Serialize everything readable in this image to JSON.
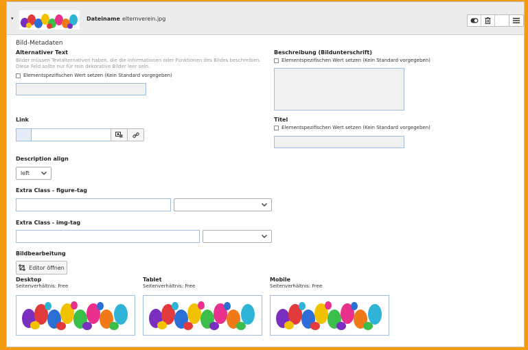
{
  "header": {
    "filename_label": "Dateiname",
    "filename_value": "elternverein.jpg"
  },
  "section_title": "Bild-Metadaten",
  "alt_text": {
    "label": "Alternativer Text",
    "description_line1": "Bilder müssen Textalternativen haben, die die Informationen oder Funktionen des Bildes beschreiben.",
    "description_line2": "Diese Feld sollte nur für rein dekorative Bilder leer sein.",
    "checkbox_label": "Elementspezifischen Wert setzen (Kein Standard vorgegeben)"
  },
  "beschreibung": {
    "label": "Beschreibung (Bildunterschrift)",
    "checkbox_label": "Elementspezifischen Wert setzen (Kein Standard vorgegeben)"
  },
  "link": {
    "label": "Link"
  },
  "titel": {
    "label": "Titel",
    "checkbox_label": "Elementspezifischen Wert setzen (Kein Standard vorgegeben)"
  },
  "description_align": {
    "label": "Description align",
    "selected": "left"
  },
  "extra_class_figure": {
    "label": "Extra Class - figure-tag"
  },
  "extra_class_img": {
    "label": "Extra Class - img-tag"
  },
  "bildbearbeitung": {
    "label": "Bildbearbeitung",
    "editor_button": "Editor öffnen"
  },
  "crops": [
    {
      "title": "Desktop",
      "ratio": "Seitenverhältnis: Free"
    },
    {
      "title": "Tablet",
      "ratio": "Seitenverhältnis: Free"
    },
    {
      "title": "Mobile",
      "ratio": "Seitenverhältnis: Free"
    }
  ],
  "colors": {
    "accent_border": "#f39c12",
    "field_border": "#9bbde0"
  }
}
